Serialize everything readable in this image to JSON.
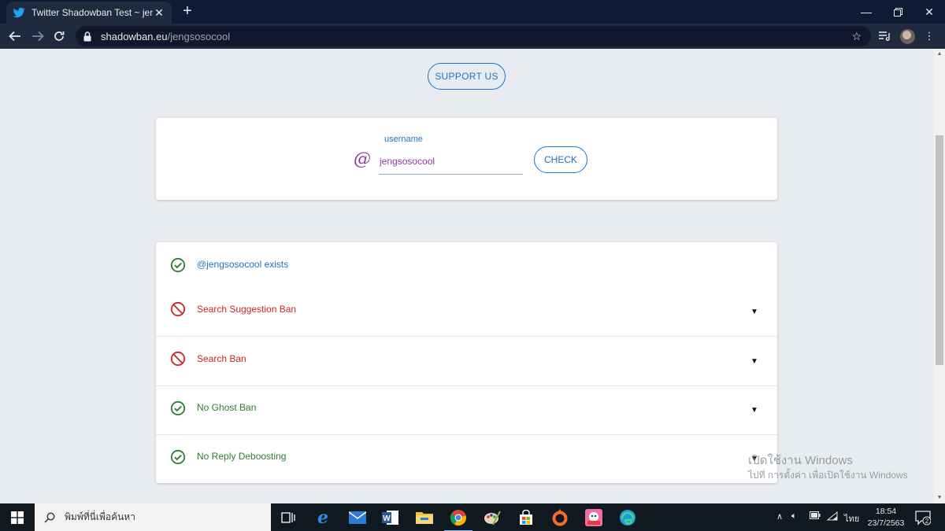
{
  "browser": {
    "tab_title": "Twitter Shadowban Test ~ jengsc",
    "url_host": "shadowban.eu",
    "url_path": "/jengsosocool"
  },
  "page": {
    "support_label": "SUPPORT US",
    "username_label": "username",
    "at_symbol": "@",
    "username_value": "jengsosocool",
    "check_label": "CHECK"
  },
  "results": [
    {
      "label": "@jengsosocool exists",
      "status": "ok",
      "expandable": false
    },
    {
      "label": "Search Suggestion Ban",
      "status": "ban",
      "expandable": true
    },
    {
      "label": "Search Ban",
      "status": "ban",
      "expandable": true
    },
    {
      "label": "No Ghost Ban",
      "status": "ok",
      "expandable": true
    },
    {
      "label": "No Reply Deboosting",
      "status": "ok",
      "expandable": true
    }
  ],
  "caret_glyph": "▼",
  "watermark": {
    "line1": "เปิดใช้งาน Windows",
    "line2": "ไปที่ การตั้งค่า เพื่อเปิดใช้งาน Windows"
  },
  "taskbar": {
    "search_placeholder": "พิมพ์ที่นี่เพื่อค้นหา",
    "language": "ไทย",
    "time": "18:54",
    "date": "23/7/2563",
    "notification_count": "2"
  },
  "colors": {
    "ok": "#2e7d32",
    "ban": "#c62828",
    "accent": "#1e73be",
    "at": "#8e3a9d"
  }
}
